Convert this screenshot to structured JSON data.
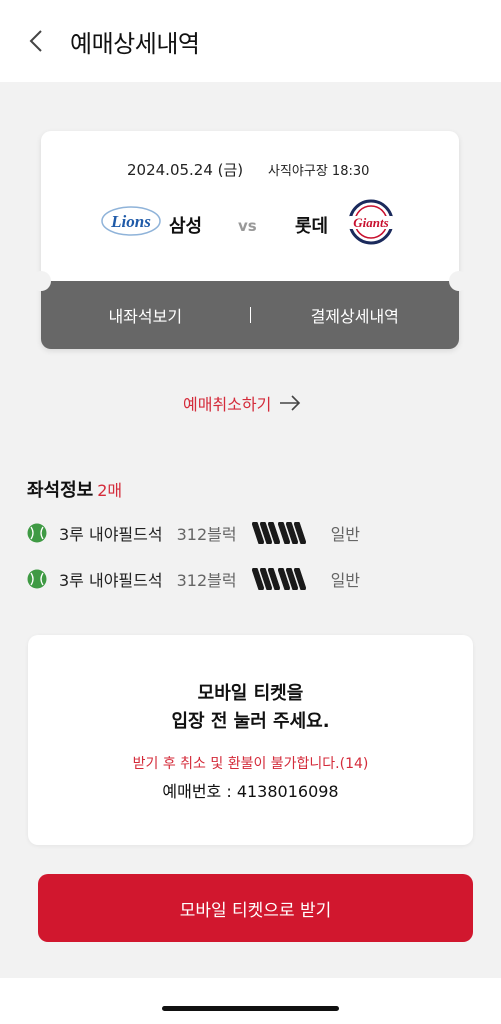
{
  "header": {
    "title": "예매상세내역"
  },
  "game": {
    "date": "2024.05.24 (금)",
    "stadium_time": "사직야구장 18:30",
    "home_team": "삼성",
    "away_team": "롯데",
    "vs": "vs",
    "home_logo_text": "Lions",
    "away_logo_text": "Giants"
  },
  "ticket_actions": {
    "my_seat": "내좌석보기",
    "payment_detail": "결제상세내역"
  },
  "cancel": {
    "label": "예매취소하기"
  },
  "seat_info": {
    "title": "좌석정보",
    "count": "2매",
    "rows": [
      {
        "zone": "3루 내야필드석",
        "block": "312블럭",
        "type": "일반"
      },
      {
        "zone": "3루 내야필드석",
        "block": "312블럭",
        "type": "일반"
      }
    ]
  },
  "mobile_ticket": {
    "line1": "모바일 티켓을",
    "line2": "입장 전 눌러 주세요.",
    "warning": "받기 후 취소 및 환불이 불가합니다.(14)",
    "booking_number": "예매번호 : 4138016098"
  },
  "receive_button": {
    "label": "모바일 티켓으로 받기"
  },
  "colors": {
    "accent_red": "#d1172e",
    "text_red": "#d42b3a",
    "ticket_bar": "#676767"
  }
}
